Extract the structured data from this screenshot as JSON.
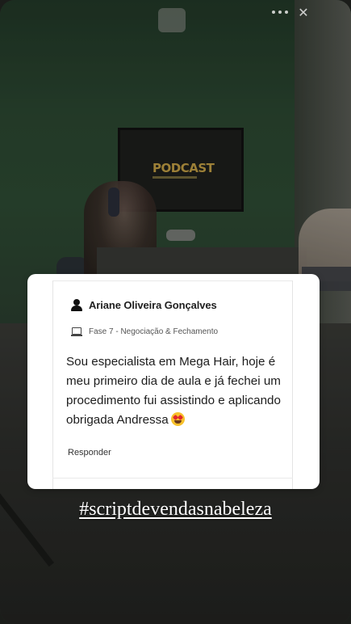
{
  "story": {
    "tv_label": "PODCAST",
    "icons": {
      "menu": "more-dots-icon",
      "close": "close-icon"
    }
  },
  "comment_card": {
    "author": "Ariane Oliveira Gonçalves",
    "lesson": "Fase 7 - Negociação & Fechamento",
    "body": "Sou especialista em Mega Hair, hoje é meu primeiro dia de aula e já fechei um procedimento fui assistindo e aplicando obrigada Andressa",
    "emoji": "heart-eyes-emoji",
    "reply_label": "Responder",
    "icons": {
      "author": "user-icon",
      "lesson": "monitor-icon"
    }
  },
  "hashtag": "#scriptdevendasnabeleza"
}
